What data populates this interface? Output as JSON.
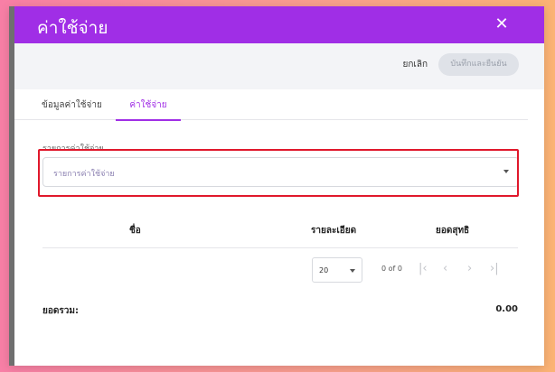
{
  "dialog": {
    "title": "ค่าใช้จ่าย",
    "close_icon": "close-icon"
  },
  "actions": {
    "cancel_label": "ยกเลิก",
    "confirm_label": "บันทึกและยืนยัน"
  },
  "tabs": [
    {
      "label": "ข้อมูลค่าใช้จ่าย",
      "active": false
    },
    {
      "label": "ค่าใช้จ่าย",
      "active": true
    }
  ],
  "expense_field": {
    "label": "รายการค่าใช้จ่าย",
    "placeholder": "รายการค่าใช้จ่าย"
  },
  "table": {
    "columns": [
      "ชื่อ",
      "รายละเอียด",
      "ยอดสุทธิ"
    ],
    "rows": []
  },
  "pagination": {
    "page_size": "20",
    "range": "0 of 0"
  },
  "summary": {
    "total_label": "ยอดรวม:",
    "total_value": "0.00"
  },
  "colors": {
    "accent": "#a02ee6",
    "highlight": "#e0182b"
  }
}
